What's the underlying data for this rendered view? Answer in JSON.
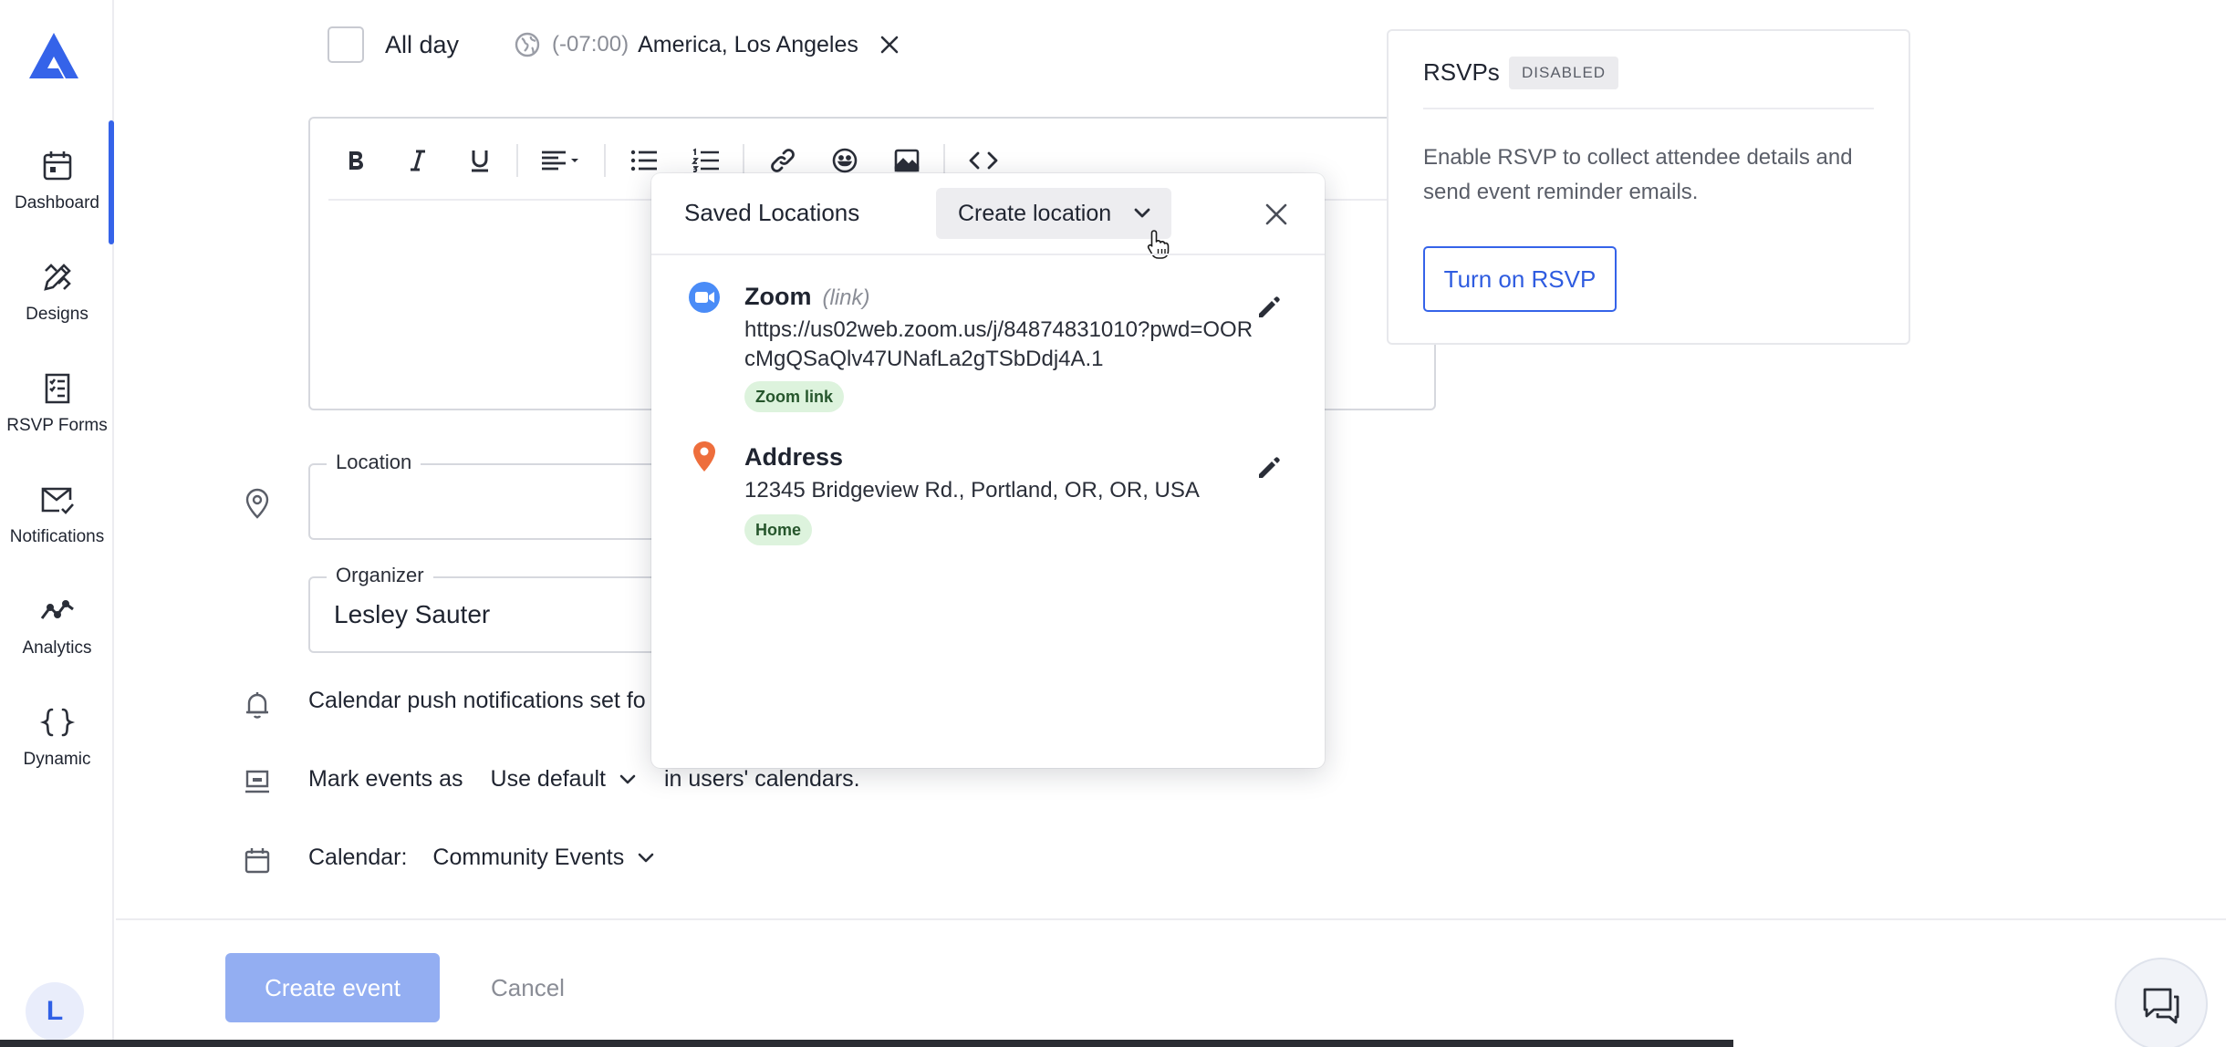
{
  "sidebar": {
    "logo_icon": "brand-logo-icon",
    "items": [
      {
        "label": "Dashboard",
        "icon": "calendar-icon",
        "active": true
      },
      {
        "label": "Designs",
        "icon": "design-tools-icon"
      },
      {
        "label": "RSVP Forms",
        "icon": "form-icon"
      },
      {
        "label": "Notifications",
        "icon": "mail-check-icon"
      },
      {
        "label": "Analytics",
        "icon": "trend-line-icon"
      },
      {
        "label": "Dynamic",
        "icon": "braces-icon"
      }
    ],
    "avatar_initial": "L",
    "accent_color": "#3563e9"
  },
  "form": {
    "all_day_label": "All day",
    "timezone_offset": "(-07:00)",
    "timezone_name": "America, Los Angeles",
    "location_label": "Location",
    "location_value": "",
    "organizer_label": "Organizer",
    "organizer_value": "Lesley Sauter",
    "push_notifications_text": "Calendar push notifications set fo",
    "mark_events_prefix": "Mark events as",
    "mark_events_value": "Use default",
    "mark_events_suffix": "in users' calendars.",
    "calendar_label": "Calendar:",
    "calendar_value": "Community Events"
  },
  "footer": {
    "create_label": "Create event",
    "cancel_label": "Cancel"
  },
  "rsvp": {
    "title": "RSVPs",
    "badge": "DISABLED",
    "description": "Enable RSVP to collect attendee details and send event reminder emails.",
    "button_label": "Turn on RSVP"
  },
  "popover": {
    "title": "Saved Locations",
    "create_label": "Create location",
    "locations": [
      {
        "name": "Zoom",
        "type": "(link)",
        "detail": "https://us02web.zoom.us/j/84874831010?pwd=OORcMgQSaQlv47UNafLa2gTSbDdj4A.1",
        "tag": "Zoom link",
        "icon": "zoom-video-icon"
      },
      {
        "name": "Address",
        "type": "",
        "detail": "12345 Bridgeview Rd., Portland, OR, OR, USA",
        "tag": "Home",
        "icon": "map-pin-icon"
      }
    ]
  }
}
